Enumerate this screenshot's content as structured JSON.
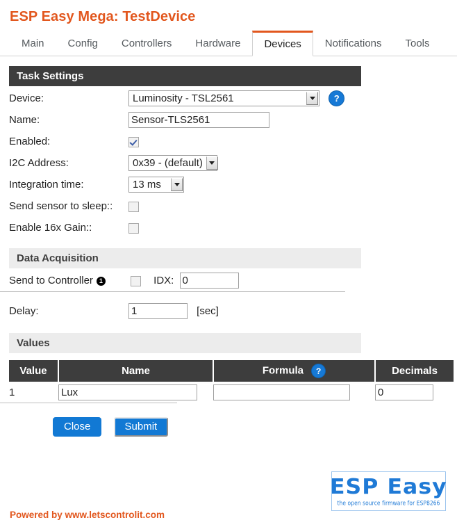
{
  "header": {
    "title": "ESP Easy Mega: TestDevice"
  },
  "tabs": [
    {
      "label": "Main",
      "active": false
    },
    {
      "label": "Config",
      "active": false
    },
    {
      "label": "Controllers",
      "active": false
    },
    {
      "label": "Hardware",
      "active": false
    },
    {
      "label": "Devices",
      "active": true
    },
    {
      "label": "Notifications",
      "active": false
    },
    {
      "label": "Tools",
      "active": false
    }
  ],
  "task_settings": {
    "heading": "Task Settings",
    "device_label": "Device:",
    "device_value": "Luminosity - TSL2561",
    "device_help_icon": "question-mark-icon",
    "name_label": "Name:",
    "name_value": "Sensor-TLS2561",
    "enabled_label": "Enabled:",
    "enabled_checked": true,
    "i2c_label": "I2C Address:",
    "i2c_value": "0x39 - (default)",
    "integration_label": "Integration time:",
    "integration_value": "13 ms",
    "sleep_label": "Send sensor to sleep::",
    "sleep_checked": false,
    "gain_label": "Enable 16x Gain::",
    "gain_checked": false
  },
  "data_acquisition": {
    "heading": "Data Acquisition",
    "send_to_controller_label": "Send to Controller",
    "controller_index_badge": "1",
    "send_checked": false,
    "idx_label": "IDX:",
    "idx_value": "0",
    "delay_label": "Delay:",
    "delay_value": "1",
    "delay_unit": "[sec]"
  },
  "values": {
    "heading": "Values",
    "columns": [
      "Value",
      "Name",
      "Formula",
      "Decimals"
    ],
    "formula_help_icon": "question-mark-icon",
    "rows": [
      {
        "index": "1",
        "name": "Lux",
        "formula": "",
        "decimals": "0"
      }
    ]
  },
  "buttons": {
    "close": "Close",
    "submit": "Submit"
  },
  "logo": {
    "main": "ESP Easy",
    "sub": "the open source firmware for ESP8266"
  },
  "footer": {
    "text": "Powered by www.letscontrolit.com"
  },
  "colors": {
    "accent_orange": "#e2571e",
    "section_dark": "#3d3d3d",
    "section_light": "#ececec",
    "button_blue": "#1279d4",
    "help_blue": "#1679d6"
  }
}
